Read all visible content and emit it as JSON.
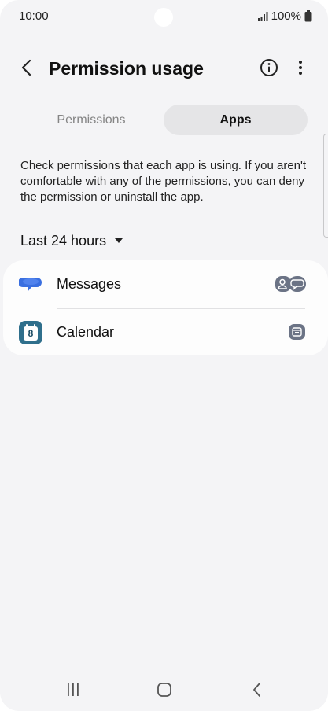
{
  "status_bar": {
    "time": "10:00",
    "battery": "100%",
    "signal_icon": "signal-bars-icon",
    "battery_icon": "battery-icon"
  },
  "header": {
    "title": "Permission usage",
    "back_icon": "chevron-left-icon",
    "info_icon": "info-circle-icon",
    "more_icon": "more-vertical-icon"
  },
  "tabs": [
    {
      "label": "Permissions",
      "selected": false
    },
    {
      "label": "Apps",
      "selected": true
    }
  ],
  "description": "Check permissions that each app is using. If you aren't comfortable with any of the permissions, you can deny the permission or uninstall the app.",
  "time_filter": {
    "label": "Last 24 hours",
    "icon": "dropdown-arrow-icon"
  },
  "apps": [
    {
      "name": "Messages",
      "icon": "messages-app-icon",
      "permission_icons": [
        "contacts-permission-icon",
        "sms-permission-icon"
      ]
    },
    {
      "name": "Calendar",
      "icon": "calendar-app-icon",
      "icon_text": "8",
      "permission_icons": [
        "calendar-permission-icon"
      ]
    }
  ],
  "nav_bar": {
    "recents_icon": "recents-icon",
    "home_icon": "home-icon",
    "back_icon": "back-icon"
  },
  "colors": {
    "background": "#f4f4f6",
    "card": "#fdfdfd",
    "selected_tab": "#e5e5e7",
    "messages_blue": "#3a6fe0",
    "calendar_teal": "#2f6f8c",
    "permission_icon": "#6b7385"
  }
}
